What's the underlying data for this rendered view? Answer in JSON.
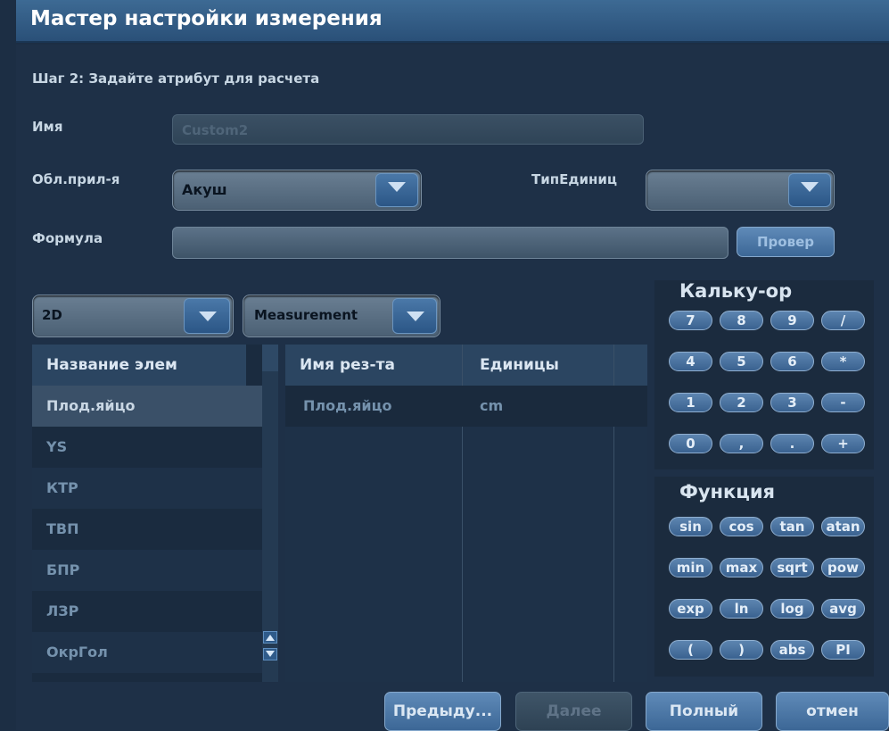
{
  "title": "Мастер настройки измерения",
  "step_text": "Шаг 2: Задайте атрибут для расчета",
  "name_label": "Имя",
  "name_placeholder": "Custom2",
  "app_area_label": "Обл.прил-я",
  "app_area_value": "Акуш",
  "unit_type_label": "ТипЕдиниц",
  "unit_type_value": "",
  "formula_label": "Формула",
  "formula_value": "",
  "check_button": "Провер",
  "mode_select_value": "2D",
  "type_select_value": "Measurement",
  "items_list": {
    "header": "Название элем",
    "items": [
      "Плод.яйцо",
      "YS",
      "КТР",
      "ТВП",
      "БПР",
      "ЛЗР",
      "ОкрГол"
    ],
    "selected_index": 0
  },
  "results_table": {
    "columns": [
      "Имя рез-та",
      "Единицы"
    ],
    "rows": [
      [
        "Плод.яйцо",
        "cm"
      ]
    ]
  },
  "calculator": {
    "title": "Кальку-ор",
    "keys": [
      [
        "7",
        "8",
        "9",
        "/"
      ],
      [
        "4",
        "5",
        "6",
        "*"
      ],
      [
        "1",
        "2",
        "3",
        "-"
      ],
      [
        "0",
        ",",
        ".",
        "+"
      ]
    ]
  },
  "functions": {
    "title": "Функция",
    "keys": [
      [
        "sin",
        "cos",
        "tan",
        "atan"
      ],
      [
        "min",
        "max",
        "sqrt",
        "pow"
      ],
      [
        "exp",
        "ln",
        "log",
        "avg"
      ],
      [
        "(",
        ")",
        "abs",
        "PI"
      ]
    ]
  },
  "footer": {
    "prev_button": "Предыду...",
    "next_button": "Далее",
    "done_button": "Полный",
    "cancel_button": "отмен"
  },
  "colors": {
    "background": "#1e3047",
    "title_bar": "#3d6a94",
    "accent_blue": "#4a78a8",
    "list_selected": "#3a5068"
  }
}
